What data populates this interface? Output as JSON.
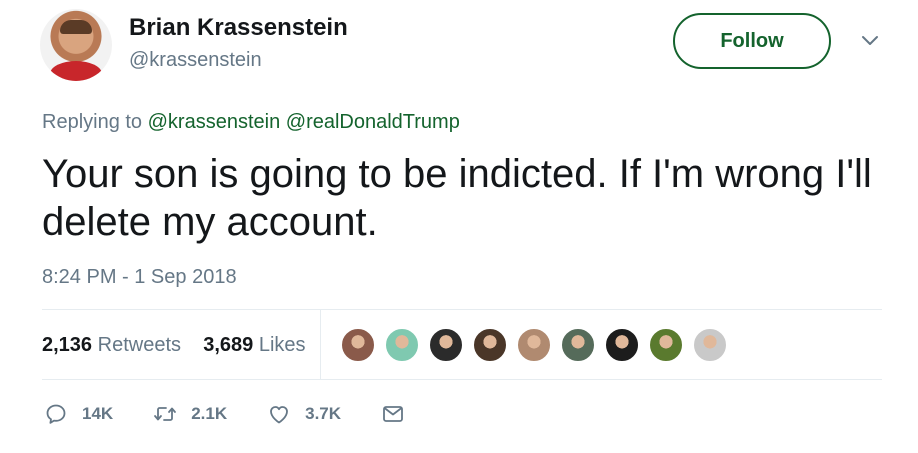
{
  "author": {
    "name": "Brian Krassenstein",
    "handle": "@krassenstein"
  },
  "follow_label": "Follow",
  "reply": {
    "prefix": "Replying to",
    "mentions": [
      "@krassenstein",
      "@realDonaldTrump"
    ]
  },
  "tweet_text": "Your son is going to be indicted. If I'm wrong I'll delete my account.",
  "timestamp": "8:24 PM - 1 Sep 2018",
  "stats": {
    "retweets_count": "2,136",
    "retweets_label": "Retweets",
    "likes_count": "3,689",
    "likes_label": "Likes"
  },
  "liker_avatar_colors": [
    "#8a5a4a",
    "#7fc9b0",
    "#2b2b2b",
    "#4a3628",
    "#b08a70",
    "#556b5a",
    "#1c1c1c",
    "#5a7a2e",
    "#c9c9c9"
  ],
  "actions": {
    "reply_count": "14K",
    "retweet_count": "2.1K",
    "like_count": "3.7K"
  },
  "colors": {
    "accent": "#14632d",
    "muted": "#657786",
    "text": "#14171a"
  },
  "icons": [
    "chevron-down-icon",
    "reply-icon",
    "retweet-icon",
    "heart-icon",
    "mail-icon"
  ]
}
